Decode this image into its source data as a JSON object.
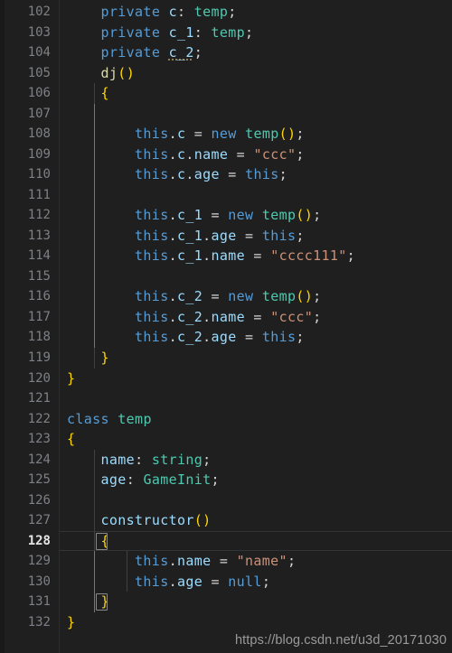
{
  "editor": {
    "theme_name": "dark-plus",
    "colors": {
      "background": "#1f1f1f",
      "gutter_text": "#7d8086",
      "active_line_number": "#e6e6e6",
      "keyword": "#569cd6",
      "type": "#4ec9b0",
      "property": "#9cdcfe",
      "function": "#dcdcaa",
      "string": "#ce9178",
      "plain": "#d4d4d4",
      "indent_guide": "#404040",
      "indent_guide_active": "#767676",
      "bracket_match_border": "#888888",
      "watermark": "#9a9a9a"
    },
    "first_line_number": 102,
    "active_line_number": 128,
    "language": "typescript"
  },
  "watermark": {
    "text": "https://blog.csdn.net/u3d_20171030"
  },
  "lines": [
    {
      "n": 102,
      "tokens": [
        {
          "t": "    ",
          "c": "plain"
        },
        {
          "t": "private",
          "c": "kw"
        },
        {
          "t": " ",
          "c": "plain"
        },
        {
          "t": "c",
          "c": "prop"
        },
        {
          "t": ": ",
          "c": "plain"
        },
        {
          "t": "temp",
          "c": "type"
        },
        {
          "t": ";",
          "c": "plain"
        }
      ]
    },
    {
      "n": 103,
      "tokens": [
        {
          "t": "    ",
          "c": "plain"
        },
        {
          "t": "private",
          "c": "kw"
        },
        {
          "t": " ",
          "c": "plain"
        },
        {
          "t": "c_1",
          "c": "prop"
        },
        {
          "t": ": ",
          "c": "plain"
        },
        {
          "t": "temp",
          "c": "type"
        },
        {
          "t": ";",
          "c": "plain"
        }
      ]
    },
    {
      "n": 104,
      "tokens": [
        {
          "t": "    ",
          "c": "plain"
        },
        {
          "t": "private",
          "c": "kw"
        },
        {
          "t": " ",
          "c": "plain"
        },
        {
          "t": "c_2",
          "c": "prop squiggle"
        },
        {
          "t": ";",
          "c": "plain"
        }
      ]
    },
    {
      "n": 105,
      "tokens": [
        {
          "t": "    ",
          "c": "plain"
        },
        {
          "t": "dj",
          "c": "fn"
        },
        {
          "t": "(",
          "c": "b1"
        },
        {
          "t": ")",
          "c": "b1"
        }
      ]
    },
    {
      "n": 106,
      "tokens": [
        {
          "t": "    ",
          "c": "plain"
        },
        {
          "t": "{",
          "c": "b1"
        }
      ]
    },
    {
      "n": 107,
      "tokens": []
    },
    {
      "n": 108,
      "tokens": [
        {
          "t": "        ",
          "c": "plain"
        },
        {
          "t": "this",
          "c": "this"
        },
        {
          "t": ".",
          "c": "plain"
        },
        {
          "t": "c",
          "c": "prop"
        },
        {
          "t": " = ",
          "c": "plain"
        },
        {
          "t": "new",
          "c": "kw"
        },
        {
          "t": " ",
          "c": "plain"
        },
        {
          "t": "temp",
          "c": "type"
        },
        {
          "t": "(",
          "c": "b1"
        },
        {
          "t": ")",
          "c": "b1"
        },
        {
          "t": ";",
          "c": "plain"
        }
      ]
    },
    {
      "n": 109,
      "tokens": [
        {
          "t": "        ",
          "c": "plain"
        },
        {
          "t": "this",
          "c": "this"
        },
        {
          "t": ".",
          "c": "plain"
        },
        {
          "t": "c",
          "c": "prop"
        },
        {
          "t": ".",
          "c": "plain"
        },
        {
          "t": "name",
          "c": "prop"
        },
        {
          "t": " = ",
          "c": "plain"
        },
        {
          "t": "\"ccc\"",
          "c": "str"
        },
        {
          "t": ";",
          "c": "plain"
        }
      ]
    },
    {
      "n": 110,
      "tokens": [
        {
          "t": "        ",
          "c": "plain"
        },
        {
          "t": "this",
          "c": "this"
        },
        {
          "t": ".",
          "c": "plain"
        },
        {
          "t": "c",
          "c": "prop"
        },
        {
          "t": ".",
          "c": "plain"
        },
        {
          "t": "age",
          "c": "prop"
        },
        {
          "t": " = ",
          "c": "plain"
        },
        {
          "t": "this",
          "c": "this"
        },
        {
          "t": ";",
          "c": "plain"
        }
      ]
    },
    {
      "n": 111,
      "tokens": []
    },
    {
      "n": 112,
      "tokens": [
        {
          "t": "        ",
          "c": "plain"
        },
        {
          "t": "this",
          "c": "this"
        },
        {
          "t": ".",
          "c": "plain"
        },
        {
          "t": "c_1",
          "c": "prop"
        },
        {
          "t": " = ",
          "c": "plain"
        },
        {
          "t": "new",
          "c": "kw"
        },
        {
          "t": " ",
          "c": "plain"
        },
        {
          "t": "temp",
          "c": "type"
        },
        {
          "t": "(",
          "c": "b1"
        },
        {
          "t": ")",
          "c": "b1"
        },
        {
          "t": ";",
          "c": "plain"
        }
      ]
    },
    {
      "n": 113,
      "tokens": [
        {
          "t": "        ",
          "c": "plain"
        },
        {
          "t": "this",
          "c": "this"
        },
        {
          "t": ".",
          "c": "plain"
        },
        {
          "t": "c_1",
          "c": "prop"
        },
        {
          "t": ".",
          "c": "plain"
        },
        {
          "t": "age",
          "c": "prop"
        },
        {
          "t": " = ",
          "c": "plain"
        },
        {
          "t": "this",
          "c": "this"
        },
        {
          "t": ";",
          "c": "plain"
        }
      ]
    },
    {
      "n": 114,
      "tokens": [
        {
          "t": "        ",
          "c": "plain"
        },
        {
          "t": "this",
          "c": "this"
        },
        {
          "t": ".",
          "c": "plain"
        },
        {
          "t": "c_1",
          "c": "prop"
        },
        {
          "t": ".",
          "c": "plain"
        },
        {
          "t": "name",
          "c": "prop"
        },
        {
          "t": " = ",
          "c": "plain"
        },
        {
          "t": "\"cccc111\"",
          "c": "str"
        },
        {
          "t": ";",
          "c": "plain"
        }
      ]
    },
    {
      "n": 115,
      "tokens": []
    },
    {
      "n": 116,
      "tokens": [
        {
          "t": "        ",
          "c": "plain"
        },
        {
          "t": "this",
          "c": "this"
        },
        {
          "t": ".",
          "c": "plain"
        },
        {
          "t": "c_2",
          "c": "prop"
        },
        {
          "t": " = ",
          "c": "plain"
        },
        {
          "t": "new",
          "c": "kw"
        },
        {
          "t": " ",
          "c": "plain"
        },
        {
          "t": "temp",
          "c": "type"
        },
        {
          "t": "(",
          "c": "b1"
        },
        {
          "t": ")",
          "c": "b1"
        },
        {
          "t": ";",
          "c": "plain"
        }
      ]
    },
    {
      "n": 117,
      "tokens": [
        {
          "t": "        ",
          "c": "plain"
        },
        {
          "t": "this",
          "c": "this"
        },
        {
          "t": ".",
          "c": "plain"
        },
        {
          "t": "c_2",
          "c": "prop"
        },
        {
          "t": ".",
          "c": "plain"
        },
        {
          "t": "name",
          "c": "prop"
        },
        {
          "t": " = ",
          "c": "plain"
        },
        {
          "t": "\"ccc\"",
          "c": "str"
        },
        {
          "t": ";",
          "c": "plain"
        }
      ]
    },
    {
      "n": 118,
      "tokens": [
        {
          "t": "        ",
          "c": "plain"
        },
        {
          "t": "this",
          "c": "this"
        },
        {
          "t": ".",
          "c": "plain"
        },
        {
          "t": "c_2",
          "c": "prop"
        },
        {
          "t": ".",
          "c": "plain"
        },
        {
          "t": "age",
          "c": "prop"
        },
        {
          "t": " = ",
          "c": "plain"
        },
        {
          "t": "this",
          "c": "this"
        },
        {
          "t": ";",
          "c": "plain"
        }
      ]
    },
    {
      "n": 119,
      "tokens": [
        {
          "t": "    ",
          "c": "plain"
        },
        {
          "t": "}",
          "c": "b1"
        }
      ]
    },
    {
      "n": 120,
      "tokens": [
        {
          "t": "}",
          "c": "b1"
        }
      ]
    },
    {
      "n": 121,
      "tokens": []
    },
    {
      "n": 122,
      "tokens": [
        {
          "t": "class",
          "c": "kw"
        },
        {
          "t": " ",
          "c": "plain"
        },
        {
          "t": "temp",
          "c": "type"
        }
      ]
    },
    {
      "n": 123,
      "tokens": [
        {
          "t": "{",
          "c": "b1"
        }
      ]
    },
    {
      "n": 124,
      "tokens": [
        {
          "t": "    ",
          "c": "plain"
        },
        {
          "t": "name",
          "c": "prop"
        },
        {
          "t": ": ",
          "c": "plain"
        },
        {
          "t": "string",
          "c": "type"
        },
        {
          "t": ";",
          "c": "plain"
        }
      ]
    },
    {
      "n": 125,
      "tokens": [
        {
          "t": "    ",
          "c": "plain"
        },
        {
          "t": "age",
          "c": "prop"
        },
        {
          "t": ": ",
          "c": "plain"
        },
        {
          "t": "GameInit",
          "c": "type"
        },
        {
          "t": ";",
          "c": "plain"
        }
      ]
    },
    {
      "n": 126,
      "tokens": []
    },
    {
      "n": 127,
      "tokens": [
        {
          "t": "    ",
          "c": "plain"
        },
        {
          "t": "constructor",
          "c": "prop"
        },
        {
          "t": "(",
          "c": "b1"
        },
        {
          "t": ")",
          "c": "b1"
        }
      ]
    },
    {
      "n": 128,
      "active": true,
      "tokens": [
        {
          "t": "    ",
          "c": "plain"
        },
        {
          "t": "{",
          "c": "b1"
        }
      ]
    },
    {
      "n": 129,
      "tokens": [
        {
          "t": "        ",
          "c": "plain"
        },
        {
          "t": "this",
          "c": "this"
        },
        {
          "t": ".",
          "c": "plain"
        },
        {
          "t": "name",
          "c": "prop"
        },
        {
          "t": " = ",
          "c": "plain"
        },
        {
          "t": "\"name\"",
          "c": "str"
        },
        {
          "t": ";",
          "c": "plain"
        }
      ]
    },
    {
      "n": 130,
      "tokens": [
        {
          "t": "        ",
          "c": "plain"
        },
        {
          "t": "this",
          "c": "this"
        },
        {
          "t": ".",
          "c": "plain"
        },
        {
          "t": "age",
          "c": "prop"
        },
        {
          "t": " = ",
          "c": "plain"
        },
        {
          "t": "null",
          "c": "kw"
        },
        {
          "t": ";",
          "c": "plain"
        }
      ]
    },
    {
      "n": 131,
      "tokens": [
        {
          "t": "    ",
          "c": "plain"
        },
        {
          "t": "}",
          "c": "b1"
        }
      ]
    },
    {
      "n": 132,
      "tokens": [
        {
          "t": "}",
          "c": "b1"
        }
      ]
    }
  ],
  "indent_guides": [
    {
      "line": 106,
      "col": 1,
      "active": false
    },
    {
      "line": 107,
      "col": 1,
      "active": true
    },
    {
      "line": 108,
      "col": 1,
      "active": true
    },
    {
      "line": 109,
      "col": 1,
      "active": true
    },
    {
      "line": 110,
      "col": 1,
      "active": true
    },
    {
      "line": 111,
      "col": 1,
      "active": true
    },
    {
      "line": 112,
      "col": 1,
      "active": true
    },
    {
      "line": 113,
      "col": 1,
      "active": true
    },
    {
      "line": 114,
      "col": 1,
      "active": true
    },
    {
      "line": 115,
      "col": 1,
      "active": true
    },
    {
      "line": 116,
      "col": 1,
      "active": true
    },
    {
      "line": 117,
      "col": 1,
      "active": true
    },
    {
      "line": 118,
      "col": 1,
      "active": true
    },
    {
      "line": 119,
      "col": 1,
      "active": false
    },
    {
      "line": 124,
      "col": 1,
      "active": false
    },
    {
      "line": 125,
      "col": 1,
      "active": false
    },
    {
      "line": 126,
      "col": 1,
      "active": false
    },
    {
      "line": 127,
      "col": 1,
      "active": false
    },
    {
      "line": 128,
      "col": 1,
      "active": false
    },
    {
      "line": 129,
      "col": 1,
      "active": true
    },
    {
      "line": 129,
      "col": 2,
      "active": false
    },
    {
      "line": 130,
      "col": 1,
      "active": true
    },
    {
      "line": 130,
      "col": 2,
      "active": false
    },
    {
      "line": 131,
      "col": 1,
      "active": true
    }
  ],
  "bracket_matches": [
    {
      "line": 128,
      "col": 1
    },
    {
      "line": 131,
      "col": 1
    }
  ]
}
